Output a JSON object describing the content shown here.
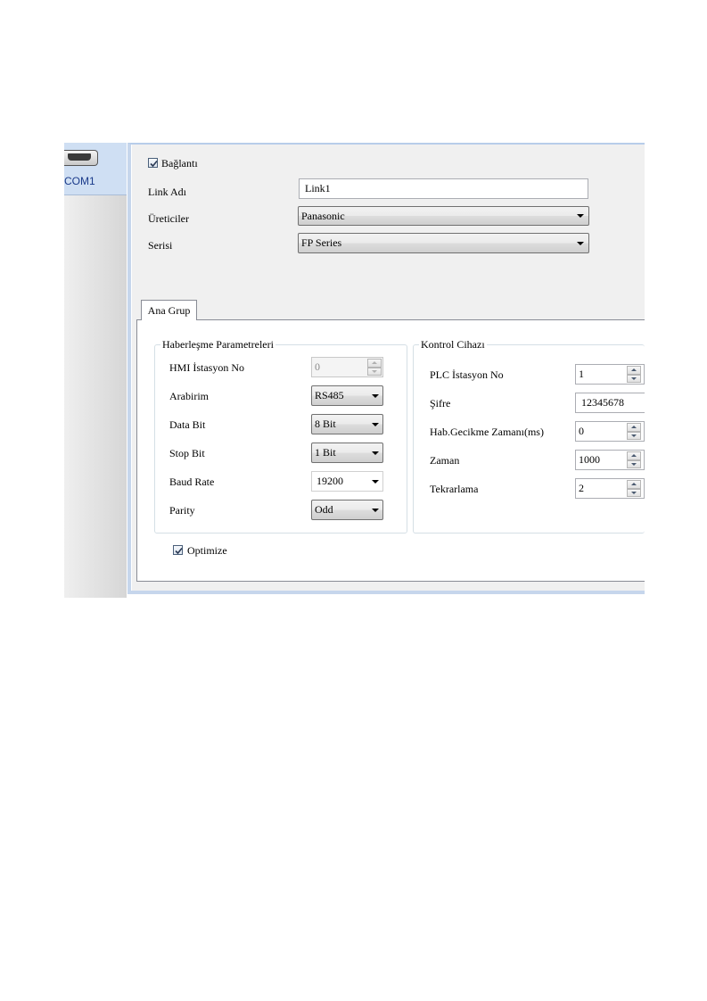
{
  "device": {
    "port_label": "COM1",
    "connector_icon": "serial-port-icon"
  },
  "link": {
    "enabled_label": "Bağlantı",
    "enabled": true,
    "name_label": "Link Adı",
    "name_value": "Link1",
    "manufacturer_label": "Üreticiler",
    "manufacturer_value": "Panasonic",
    "series_label": "Serisi",
    "series_value": "FP Series"
  },
  "tabs": [
    {
      "label": "Ana Grup",
      "selected": true
    }
  ],
  "comm_params": {
    "title": "Haberleşme Parametreleri",
    "hmi_station_label": "HMI İstasyon No",
    "hmi_station_value": "0",
    "interface_label": "Arabirim",
    "interface_value": "RS485",
    "data_bit_label": "Data Bit",
    "data_bit_value": "8 Bit",
    "stop_bit_label": "Stop Bit",
    "stop_bit_value": "1 Bit",
    "baud_rate_label": "Baud Rate",
    "baud_rate_value": "19200",
    "parity_label": "Parity",
    "parity_value": "Odd"
  },
  "controller": {
    "title": "Kontrol Cihazı",
    "plc_station_label": "PLC İstasyon No",
    "plc_station_value": "1",
    "password_label": "Şifre",
    "password_value": "12345678",
    "comm_delay_label": "Hab.Gecikme Zamanı(ms)",
    "comm_delay_value": "0",
    "timeout_label": "Zaman",
    "timeout_value": "1000",
    "retry_label": "Tekrarlama",
    "retry_value": "2"
  },
  "optimize": {
    "label": "Optimize",
    "checked": true
  },
  "colors": {
    "panel_border": "#c6d6ec",
    "panel_bg": "#f0f0f0",
    "port_label": "#1a3a8a"
  }
}
